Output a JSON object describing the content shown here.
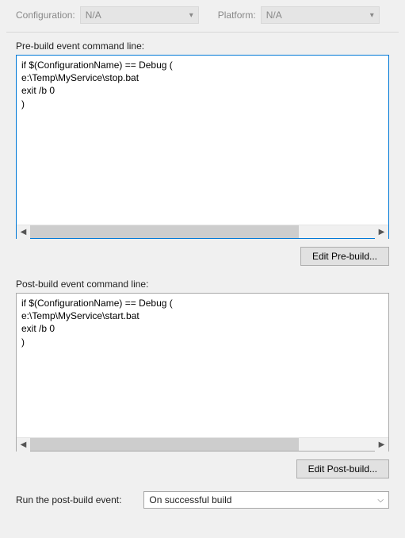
{
  "top": {
    "config_label": "Configuration:",
    "config_value": "N/A",
    "platform_label": "Platform:",
    "platform_value": "N/A"
  },
  "prebuild": {
    "label": "Pre-build event command line:",
    "text": "if $(ConfigurationName) == Debug (\ne:\\Temp\\MyService\\stop.bat\nexit /b 0\n)",
    "button": "Edit Pre-build..."
  },
  "postbuild": {
    "label": "Post-build event command line:",
    "text": "if $(ConfigurationName) == Debug (\ne:\\Temp\\MyService\\start.bat\nexit /b 0\n)",
    "button": "Edit Post-build..."
  },
  "run": {
    "label": "Run the post-build event:",
    "selected": "On successful build"
  }
}
